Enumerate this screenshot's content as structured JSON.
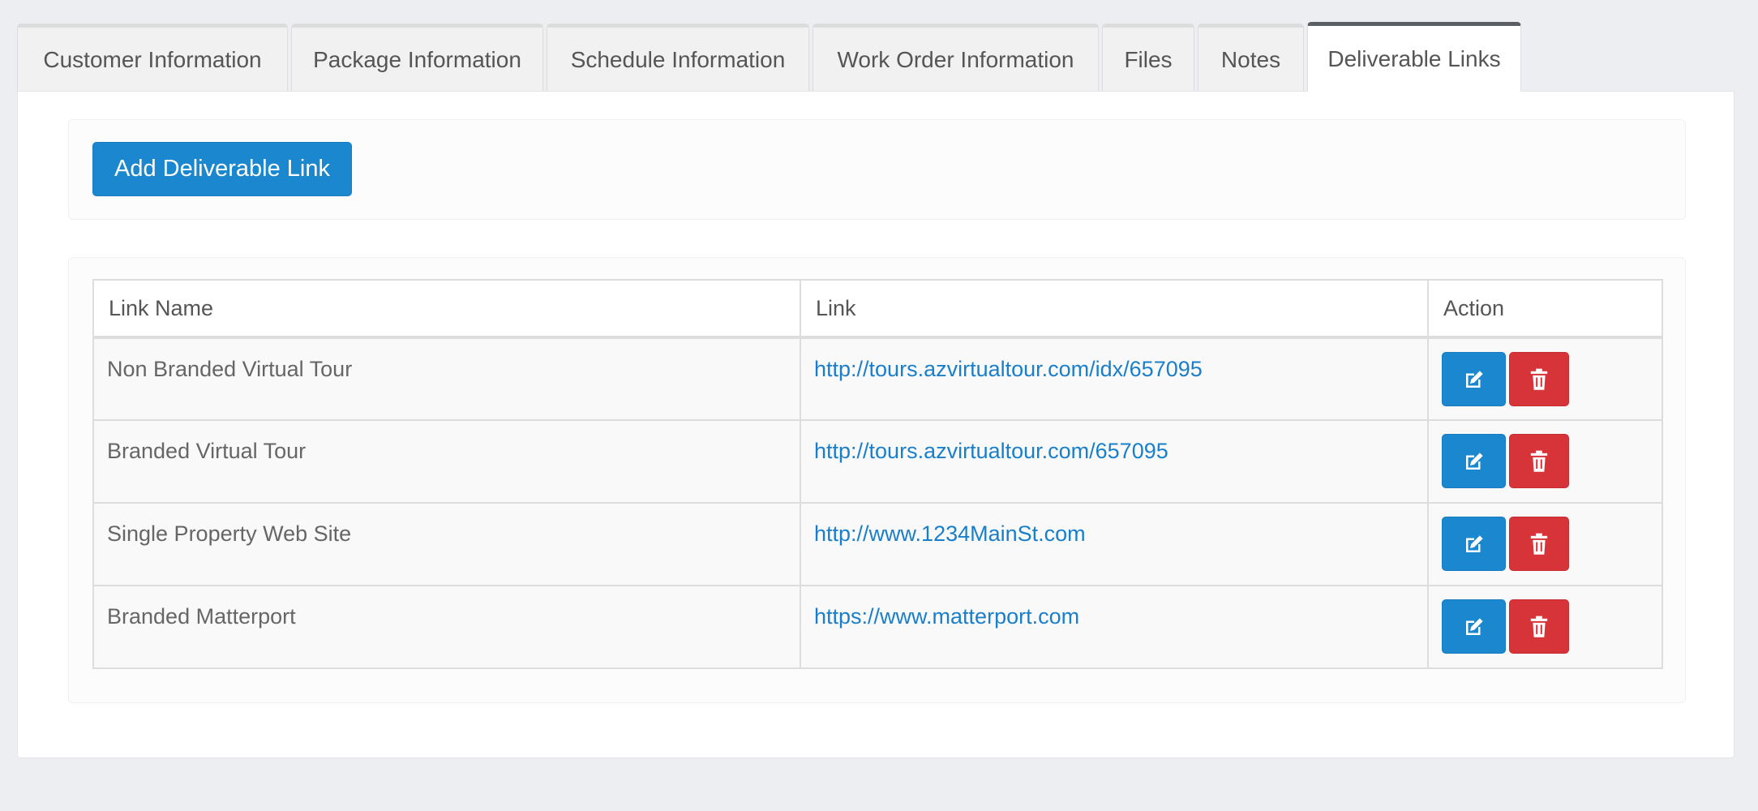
{
  "tabs": [
    {
      "label": "Customer Information",
      "active": false
    },
    {
      "label": "Package Information",
      "active": false
    },
    {
      "label": "Schedule Information",
      "active": false
    },
    {
      "label": "Work Order Information",
      "active": false
    },
    {
      "label": "Files",
      "active": false
    },
    {
      "label": "Notes",
      "active": false
    },
    {
      "label": "Deliverable Links",
      "active": true
    }
  ],
  "toolbar": {
    "add_label": "Add Deliverable Link"
  },
  "table": {
    "headers": [
      "Link Name",
      "Link",
      "Action"
    ],
    "rows": [
      {
        "name": "Non Branded Virtual Tour",
        "link": "http://tours.azvirtualtour.com/idx/657095"
      },
      {
        "name": "Branded Virtual Tour",
        "link": "http://tours.azvirtualtour.com/657095"
      },
      {
        "name": "Single Property Web Site",
        "link": "http://www.1234MainSt.com"
      },
      {
        "name": "Branded Matterport",
        "link": "https://www.matterport.com"
      }
    ]
  },
  "icons": {
    "edit": "edit-icon",
    "delete": "trash-icon"
  },
  "colors": {
    "primary": "#1a87cf",
    "danger": "#d7343a",
    "link": "#1a7fcb",
    "active_tab_border": "#5a5f66"
  }
}
